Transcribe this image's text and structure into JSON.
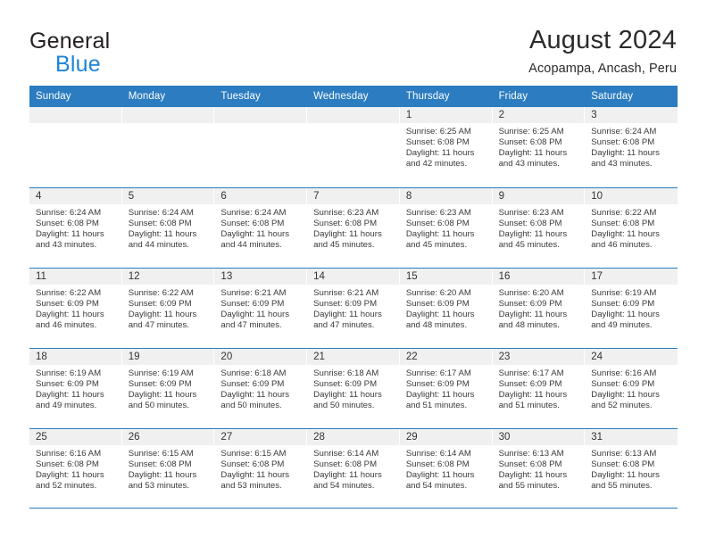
{
  "brand": {
    "line1": "General",
    "line2": "Blue",
    "triangle_color": "#1b6cb3",
    "blue_text_color": "#1f84d6"
  },
  "header": {
    "title": "August 2024",
    "subtitle": "Acopampa, Ancash, Peru"
  },
  "theme": {
    "header_blue": "#2b7cc1",
    "day_band_gray": "#f0f0f0",
    "text": "#2b2b2b"
  },
  "weekdays": [
    "Sunday",
    "Monday",
    "Tuesday",
    "Wednesday",
    "Thursday",
    "Friday",
    "Saturday"
  ],
  "weeks": [
    [
      {
        "day": "",
        "sunrise": "",
        "sunset": "",
        "daylight1": "",
        "daylight2": ""
      },
      {
        "day": "",
        "sunrise": "",
        "sunset": "",
        "daylight1": "",
        "daylight2": ""
      },
      {
        "day": "",
        "sunrise": "",
        "sunset": "",
        "daylight1": "",
        "daylight2": ""
      },
      {
        "day": "",
        "sunrise": "",
        "sunset": "",
        "daylight1": "",
        "daylight2": ""
      },
      {
        "day": "1",
        "sunrise": "Sunrise: 6:25 AM",
        "sunset": "Sunset: 6:08 PM",
        "daylight1": "Daylight: 11 hours",
        "daylight2": "and 42 minutes."
      },
      {
        "day": "2",
        "sunrise": "Sunrise: 6:25 AM",
        "sunset": "Sunset: 6:08 PM",
        "daylight1": "Daylight: 11 hours",
        "daylight2": "and 43 minutes."
      },
      {
        "day": "3",
        "sunrise": "Sunrise: 6:24 AM",
        "sunset": "Sunset: 6:08 PM",
        "daylight1": "Daylight: 11 hours",
        "daylight2": "and 43 minutes."
      }
    ],
    [
      {
        "day": "4",
        "sunrise": "Sunrise: 6:24 AM",
        "sunset": "Sunset: 6:08 PM",
        "daylight1": "Daylight: 11 hours",
        "daylight2": "and 43 minutes."
      },
      {
        "day": "5",
        "sunrise": "Sunrise: 6:24 AM",
        "sunset": "Sunset: 6:08 PM",
        "daylight1": "Daylight: 11 hours",
        "daylight2": "and 44 minutes."
      },
      {
        "day": "6",
        "sunrise": "Sunrise: 6:24 AM",
        "sunset": "Sunset: 6:08 PM",
        "daylight1": "Daylight: 11 hours",
        "daylight2": "and 44 minutes."
      },
      {
        "day": "7",
        "sunrise": "Sunrise: 6:23 AM",
        "sunset": "Sunset: 6:08 PM",
        "daylight1": "Daylight: 11 hours",
        "daylight2": "and 45 minutes."
      },
      {
        "day": "8",
        "sunrise": "Sunrise: 6:23 AM",
        "sunset": "Sunset: 6:08 PM",
        "daylight1": "Daylight: 11 hours",
        "daylight2": "and 45 minutes."
      },
      {
        "day": "9",
        "sunrise": "Sunrise: 6:23 AM",
        "sunset": "Sunset: 6:08 PM",
        "daylight1": "Daylight: 11 hours",
        "daylight2": "and 45 minutes."
      },
      {
        "day": "10",
        "sunrise": "Sunrise: 6:22 AM",
        "sunset": "Sunset: 6:08 PM",
        "daylight1": "Daylight: 11 hours",
        "daylight2": "and 46 minutes."
      }
    ],
    [
      {
        "day": "11",
        "sunrise": "Sunrise: 6:22 AM",
        "sunset": "Sunset: 6:09 PM",
        "daylight1": "Daylight: 11 hours",
        "daylight2": "and 46 minutes."
      },
      {
        "day": "12",
        "sunrise": "Sunrise: 6:22 AM",
        "sunset": "Sunset: 6:09 PM",
        "daylight1": "Daylight: 11 hours",
        "daylight2": "and 47 minutes."
      },
      {
        "day": "13",
        "sunrise": "Sunrise: 6:21 AM",
        "sunset": "Sunset: 6:09 PM",
        "daylight1": "Daylight: 11 hours",
        "daylight2": "and 47 minutes."
      },
      {
        "day": "14",
        "sunrise": "Sunrise: 6:21 AM",
        "sunset": "Sunset: 6:09 PM",
        "daylight1": "Daylight: 11 hours",
        "daylight2": "and 47 minutes."
      },
      {
        "day": "15",
        "sunrise": "Sunrise: 6:20 AM",
        "sunset": "Sunset: 6:09 PM",
        "daylight1": "Daylight: 11 hours",
        "daylight2": "and 48 minutes."
      },
      {
        "day": "16",
        "sunrise": "Sunrise: 6:20 AM",
        "sunset": "Sunset: 6:09 PM",
        "daylight1": "Daylight: 11 hours",
        "daylight2": "and 48 minutes."
      },
      {
        "day": "17",
        "sunrise": "Sunrise: 6:19 AM",
        "sunset": "Sunset: 6:09 PM",
        "daylight1": "Daylight: 11 hours",
        "daylight2": "and 49 minutes."
      }
    ],
    [
      {
        "day": "18",
        "sunrise": "Sunrise: 6:19 AM",
        "sunset": "Sunset: 6:09 PM",
        "daylight1": "Daylight: 11 hours",
        "daylight2": "and 49 minutes."
      },
      {
        "day": "19",
        "sunrise": "Sunrise: 6:19 AM",
        "sunset": "Sunset: 6:09 PM",
        "daylight1": "Daylight: 11 hours",
        "daylight2": "and 50 minutes."
      },
      {
        "day": "20",
        "sunrise": "Sunrise: 6:18 AM",
        "sunset": "Sunset: 6:09 PM",
        "daylight1": "Daylight: 11 hours",
        "daylight2": "and 50 minutes."
      },
      {
        "day": "21",
        "sunrise": "Sunrise: 6:18 AM",
        "sunset": "Sunset: 6:09 PM",
        "daylight1": "Daylight: 11 hours",
        "daylight2": "and 50 minutes."
      },
      {
        "day": "22",
        "sunrise": "Sunrise: 6:17 AM",
        "sunset": "Sunset: 6:09 PM",
        "daylight1": "Daylight: 11 hours",
        "daylight2": "and 51 minutes."
      },
      {
        "day": "23",
        "sunrise": "Sunrise: 6:17 AM",
        "sunset": "Sunset: 6:09 PM",
        "daylight1": "Daylight: 11 hours",
        "daylight2": "and 51 minutes."
      },
      {
        "day": "24",
        "sunrise": "Sunrise: 6:16 AM",
        "sunset": "Sunset: 6:09 PM",
        "daylight1": "Daylight: 11 hours",
        "daylight2": "and 52 minutes."
      }
    ],
    [
      {
        "day": "25",
        "sunrise": "Sunrise: 6:16 AM",
        "sunset": "Sunset: 6:08 PM",
        "daylight1": "Daylight: 11 hours",
        "daylight2": "and 52 minutes."
      },
      {
        "day": "26",
        "sunrise": "Sunrise: 6:15 AM",
        "sunset": "Sunset: 6:08 PM",
        "daylight1": "Daylight: 11 hours",
        "daylight2": "and 53 minutes."
      },
      {
        "day": "27",
        "sunrise": "Sunrise: 6:15 AM",
        "sunset": "Sunset: 6:08 PM",
        "daylight1": "Daylight: 11 hours",
        "daylight2": "and 53 minutes."
      },
      {
        "day": "28",
        "sunrise": "Sunrise: 6:14 AM",
        "sunset": "Sunset: 6:08 PM",
        "daylight1": "Daylight: 11 hours",
        "daylight2": "and 54 minutes."
      },
      {
        "day": "29",
        "sunrise": "Sunrise: 6:14 AM",
        "sunset": "Sunset: 6:08 PM",
        "daylight1": "Daylight: 11 hours",
        "daylight2": "and 54 minutes."
      },
      {
        "day": "30",
        "sunrise": "Sunrise: 6:13 AM",
        "sunset": "Sunset: 6:08 PM",
        "daylight1": "Daylight: 11 hours",
        "daylight2": "and 55 minutes."
      },
      {
        "day": "31",
        "sunrise": "Sunrise: 6:13 AM",
        "sunset": "Sunset: 6:08 PM",
        "daylight1": "Daylight: 11 hours",
        "daylight2": "and 55 minutes."
      }
    ]
  ]
}
